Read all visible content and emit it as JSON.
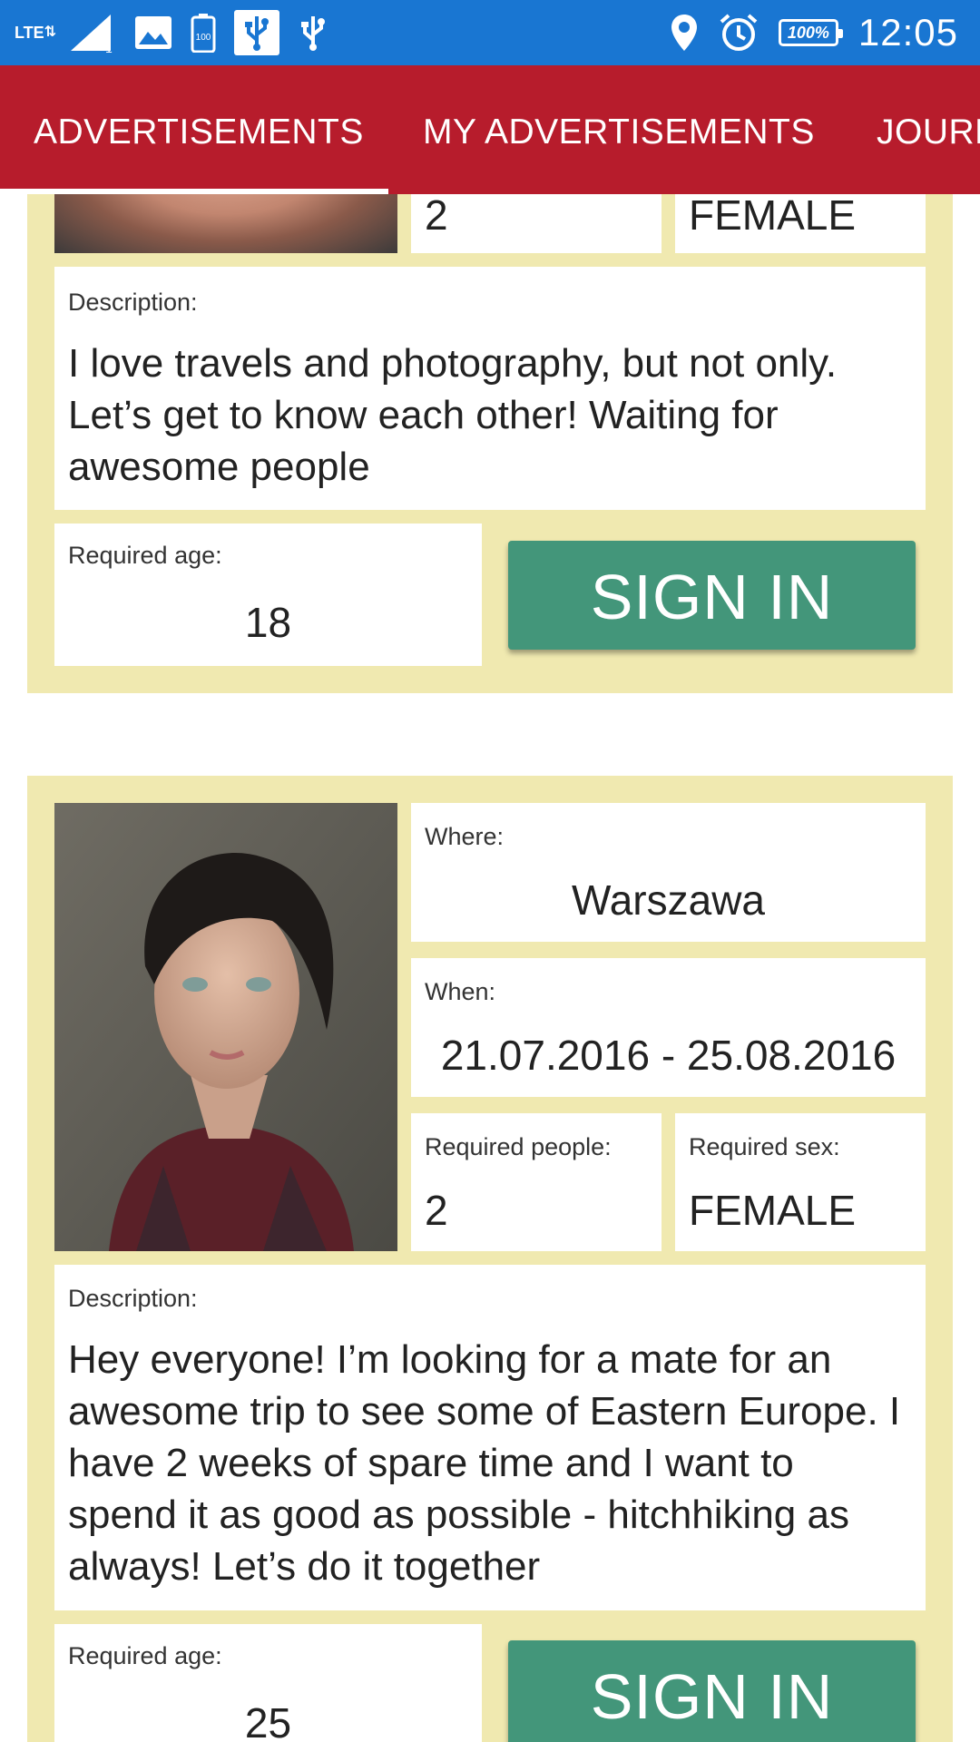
{
  "status_bar": {
    "network": "LTE",
    "signal_sub": "1",
    "battery_icon_label": "100",
    "battery_percent": "100%",
    "time": "12:05",
    "icons": [
      "lte-icon",
      "signal-icon",
      "image-icon",
      "battery-saver-icon",
      "usb-icon",
      "usb-icon",
      "location-icon",
      "alarm-icon",
      "battery-icon"
    ]
  },
  "tabs": [
    {
      "label": "ADVERTISEMENTS",
      "selected": true
    },
    {
      "label": "MY ADVERTISEMENTS",
      "selected": false
    },
    {
      "label": "JOURNEYS",
      "selected": false
    }
  ],
  "colors": {
    "status_bar": "#1976d2",
    "tab_bar": "#b71c2c",
    "card_background": "#f0e9b0",
    "sign_in_button": "#43967a"
  },
  "cards": [
    {
      "required_people": "2",
      "required_sex": "FEMALE",
      "description_label": "Description:",
      "description": "I love travels and photography, but not only. Let’s get to know each other! Waiting for awesome people",
      "required_age_label": "Required age:",
      "required_age": "18",
      "sign_in_label": "SIGN IN"
    },
    {
      "where_label": "Where:",
      "where": "Warszawa",
      "when_label": "When:",
      "when": "21.07.2016 - 25.08.2016",
      "required_people_label": "Required people:",
      "required_people": "2",
      "required_sex_label": "Required sex:",
      "required_sex": "FEMALE",
      "description_label": "Description:",
      "description": "Hey everyone! I’m looking for a mate for an awesome trip to see some of Eastern Europe. I have 2 weeks of spare time and I want to spend it as good as possible - hitchhiking as always! Let’s do it together",
      "required_age_label": "Required age:",
      "required_age": "25",
      "sign_in_label": "SIGN IN"
    }
  ]
}
